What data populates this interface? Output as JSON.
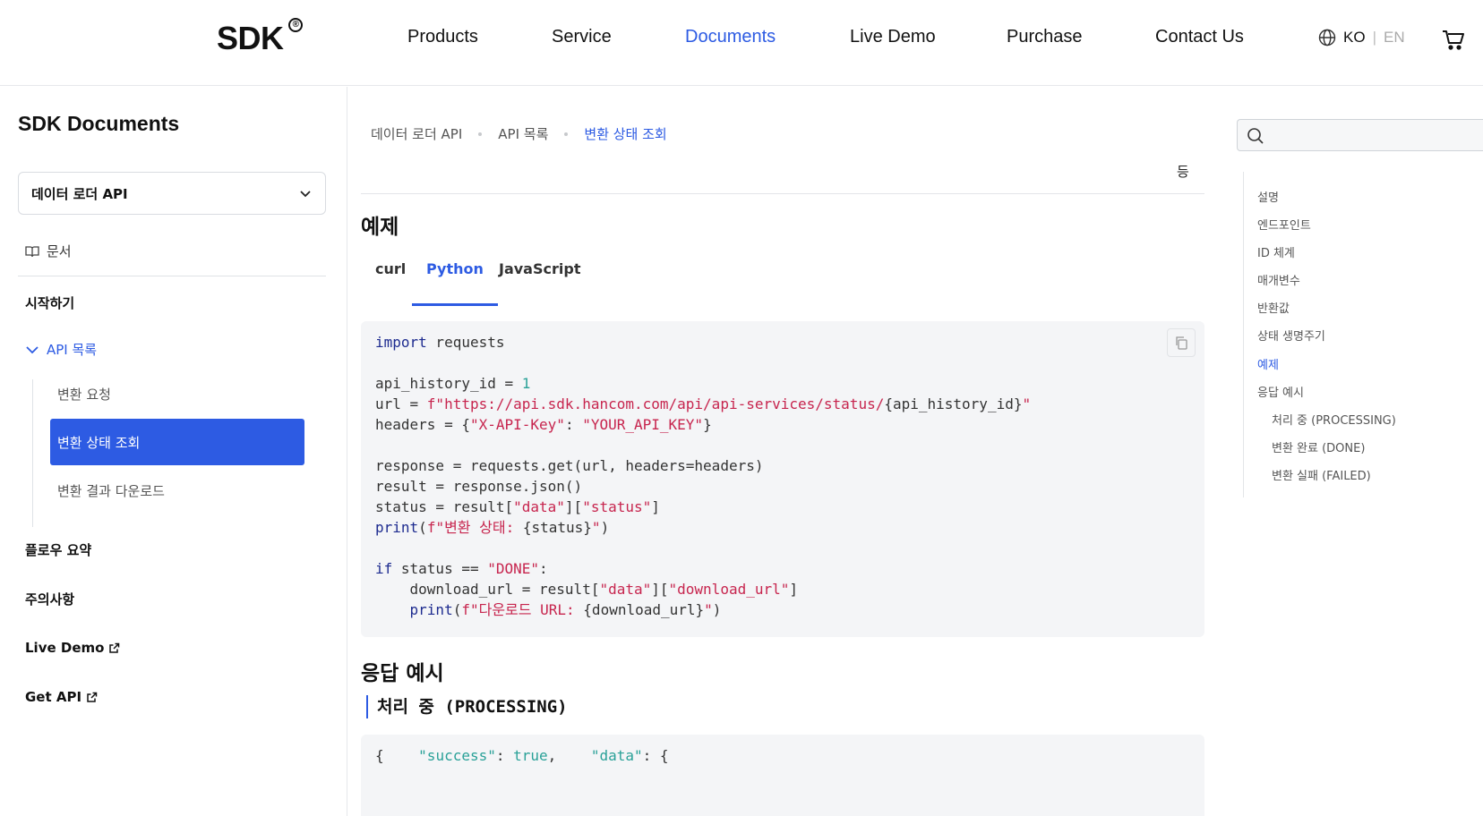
{
  "header": {
    "logo": "SDK",
    "logo_mark": "®",
    "nav": [
      {
        "label": "Products",
        "active": false
      },
      {
        "label": "Service",
        "active": false
      },
      {
        "label": "Documents",
        "active": true
      },
      {
        "label": "Live Demo",
        "active": false
      },
      {
        "label": "Purchase",
        "active": false
      },
      {
        "label": "Contact Us",
        "active": false
      }
    ],
    "lang": {
      "ko": "KO",
      "sep": "|",
      "en": "EN"
    }
  },
  "sidebar": {
    "title": "SDK Documents",
    "select_value": "데이터 로더 API",
    "doc_link": "문서",
    "items": {
      "getting_started": "시작하기",
      "api_list": "API 목록",
      "flow_summary": "플로우 요약",
      "notes": "주의사항",
      "live_demo": "Live Demo",
      "get_api": "Get API"
    },
    "sub_items": [
      {
        "label": "변환 요청",
        "active": false
      },
      {
        "label": "변환 상태 조회",
        "active": true
      },
      {
        "label": "변환 결과 다운로드",
        "active": false
      }
    ]
  },
  "main": {
    "breadcrumb": [
      "데이터 로더 API",
      "API 목록",
      "변환 상태 조회"
    ],
    "truncated_text": "등",
    "example_heading": "예제",
    "tabs": [
      {
        "label": "curl",
        "active": false
      },
      {
        "label": "Python",
        "active": true
      },
      {
        "label": "JavaScript",
        "active": false
      }
    ],
    "code": {
      "l1_kw": "import",
      "l1_rest": " requests",
      "l3_a": "api_history_id = ",
      "l3_num": "1",
      "l4_a": "url = ",
      "l4_str": "f\"https://api.sdk.hancom.com/api/api-services/status/",
      "l4_b": "{api_history_id}",
      "l4_str2": "\"",
      "l5_a": "headers = {",
      "l5_s1": "\"X-API-Key\"",
      "l5_b": ": ",
      "l5_s2": "\"YOUR_API_KEY\"",
      "l5_c": "}",
      "l7": "response = requests.get(url, headers=headers)",
      "l8": "result = response.json()",
      "l9_a": "status = result[",
      "l9_s1": "\"data\"",
      "l9_b": "][",
      "l9_s2": "\"status\"",
      "l9_c": "]",
      "l10_kw": "print",
      "l10_a": "(",
      "l10_s": "f\"변환 상태: ",
      "l10_b": "{status}",
      "l10_s2": "\"",
      "l10_c": ")",
      "l12_kw": "if",
      "l12_a": " status == ",
      "l12_s": "\"DONE\"",
      "l12_b": ":",
      "l13_a": "    download_url = result[",
      "l13_s1": "\"data\"",
      "l13_b": "][",
      "l13_s2": "\"download_url\"",
      "l13_c": "]",
      "l14_pad": "    ",
      "l14_kw": "print",
      "l14_a": "(",
      "l14_s": "f\"다운로드 URL: ",
      "l14_b": "{download_url}",
      "l14_s2": "\"",
      "l14_c": ")"
    },
    "response_heading": "응답 예시",
    "processing_heading": "처리 중 (PROCESSING)",
    "code2": {
      "l1": "{",
      "l2_pad": "    ",
      "l2_key": "\"success\"",
      "l2_a": ": ",
      "l2_val": "true",
      "l2_b": ",",
      "l3_pad": "    ",
      "l3_key": "\"data\"",
      "l3_a": ": {"
    }
  },
  "toc": {
    "search_placeholder": "",
    "items": [
      {
        "label": "설명",
        "active": false,
        "sub": false
      },
      {
        "label": "엔드포인트",
        "active": false,
        "sub": false
      },
      {
        "label": "ID 체계",
        "active": false,
        "sub": false
      },
      {
        "label": "매개변수",
        "active": false,
        "sub": false
      },
      {
        "label": "반환값",
        "active": false,
        "sub": false
      },
      {
        "label": "상태 생명주기",
        "active": false,
        "sub": false
      },
      {
        "label": "예제",
        "active": true,
        "sub": false
      },
      {
        "label": "응답 예시",
        "active": false,
        "sub": false
      },
      {
        "label": "처리 중 (PROCESSING)",
        "active": false,
        "sub": true
      },
      {
        "label": "변환 완료 (DONE)",
        "active": false,
        "sub": true
      },
      {
        "label": "변환 실패 (FAILED)",
        "active": false,
        "sub": true
      }
    ]
  },
  "colors": {
    "accent": "#2d5be3",
    "code_bg": "#f4f5f7",
    "string": "#c7254e",
    "keyword": "#1d2b8f"
  }
}
